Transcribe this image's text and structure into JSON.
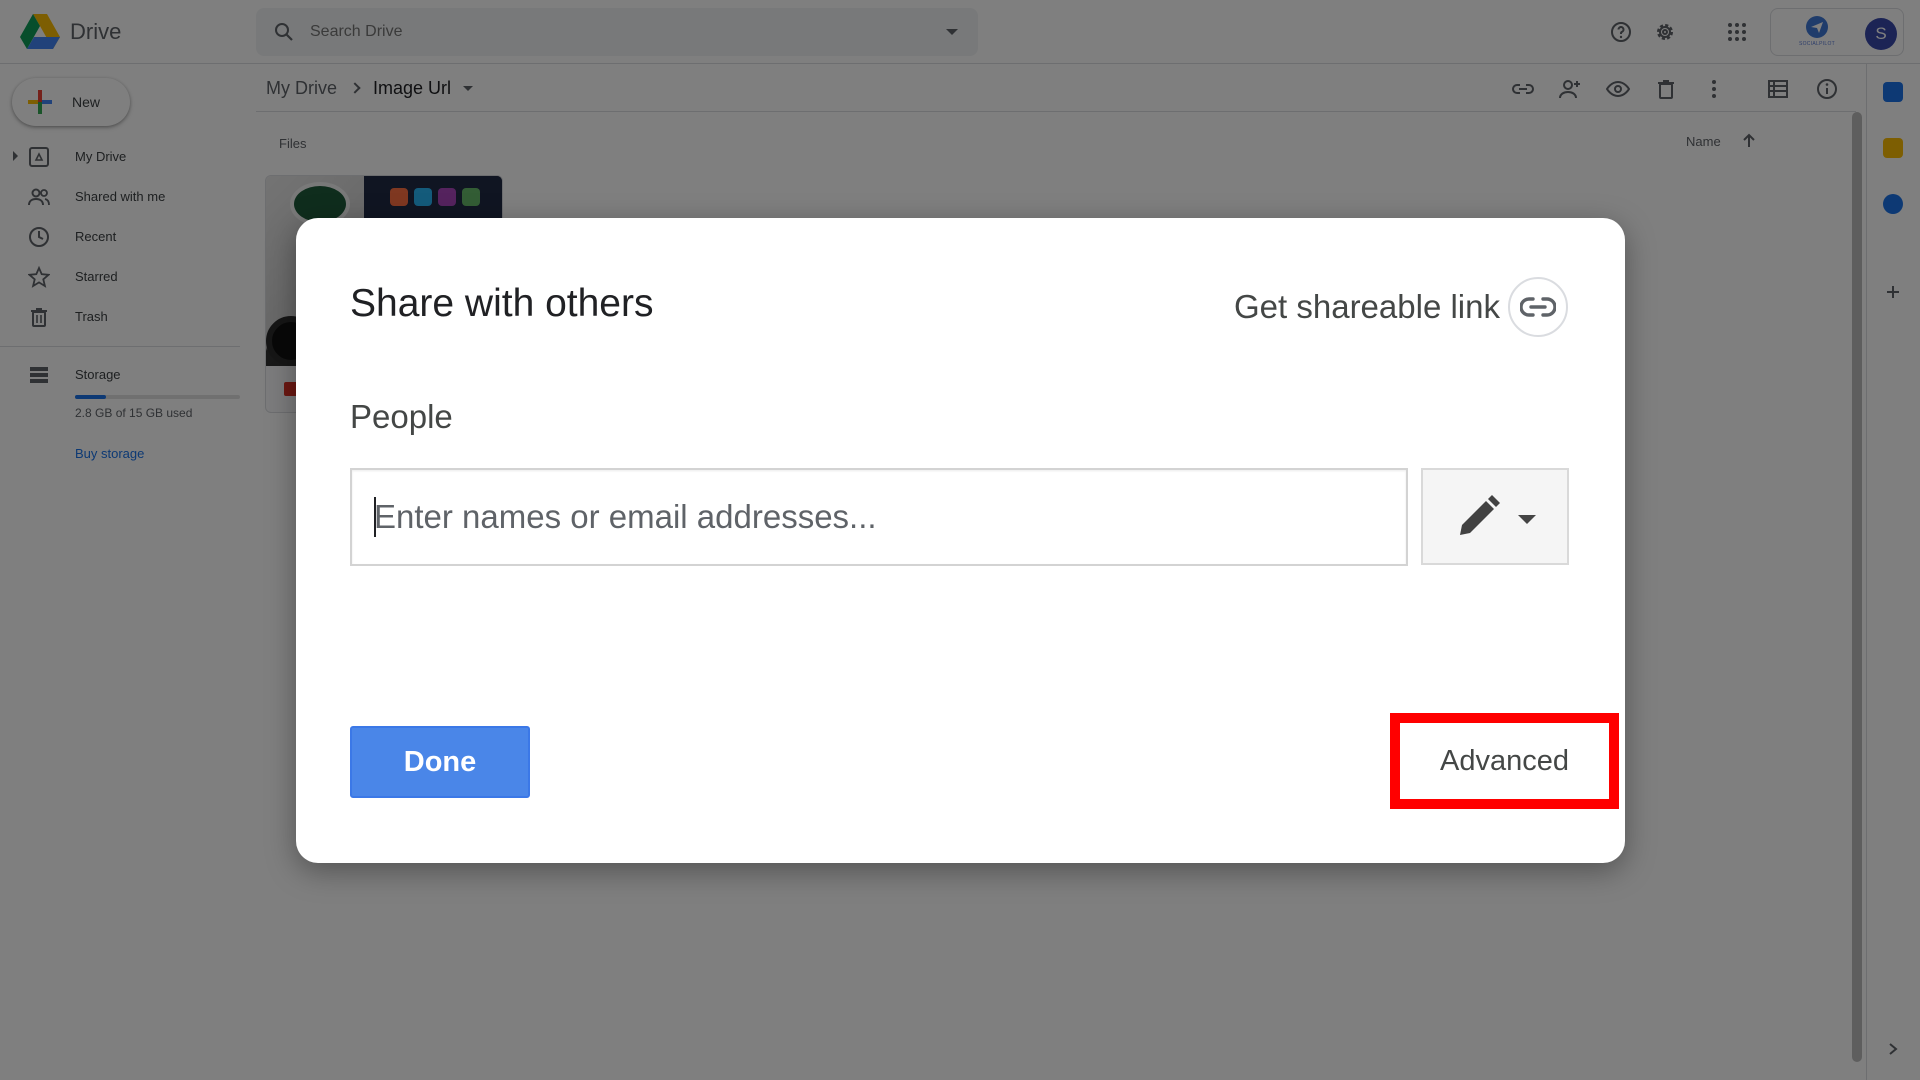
{
  "app": {
    "name": "Drive"
  },
  "search": {
    "placeholder": "Search Drive"
  },
  "brand": {
    "text": "SOCIALPILOT"
  },
  "account": {
    "initial": "S"
  },
  "sidebar": {
    "new_label": "New",
    "items": [
      {
        "label": "My Drive"
      },
      {
        "label": "Shared with me"
      },
      {
        "label": "Recent"
      },
      {
        "label": "Starred"
      },
      {
        "label": "Trash"
      }
    ],
    "storage": {
      "label": "Storage",
      "usage_text": "2.8 GB of 15 GB used",
      "used_fraction": 0.187,
      "buy_label": "Buy storage"
    }
  },
  "breadcrumb": {
    "root": "My Drive",
    "current": "Image Url"
  },
  "main": {
    "section_label": "Files",
    "sort_label": "Name"
  },
  "colors": {
    "accent": "#1a73e8",
    "done_button": "#4a86e8",
    "highlight": "#ff0000"
  },
  "dialog": {
    "title": "Share with others",
    "shareable_link_label": "Get shareable link",
    "people_label": "People",
    "people_input_placeholder": "Enter names or email addresses...",
    "done_label": "Done",
    "advanced_label": "Advanced"
  }
}
